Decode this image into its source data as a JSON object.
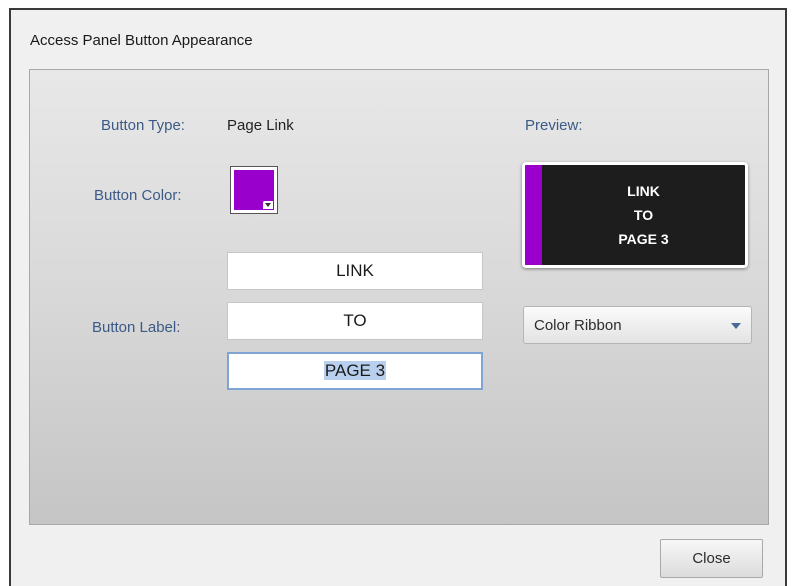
{
  "dialog": {
    "title": "Access Panel Button Appearance"
  },
  "form": {
    "button_type_label": "Button Type:",
    "button_type_value": "Page Link",
    "button_color_label": "Button Color:",
    "button_color_value": "#9900cc",
    "button_label_label": "Button Label:",
    "label_lines": [
      "LINK",
      "TO",
      "PAGE 3"
    ],
    "selected_line_index": 2
  },
  "preview": {
    "title": "Preview:",
    "lines": [
      "LINK",
      "TO",
      "PAGE 3"
    ],
    "background_color": "#1d1d1d",
    "ribbon_color": "#9900cc"
  },
  "style_dropdown": {
    "selected": "Color Ribbon",
    "icon": "chevron-down-icon"
  },
  "footer": {
    "close_label": "Close"
  }
}
